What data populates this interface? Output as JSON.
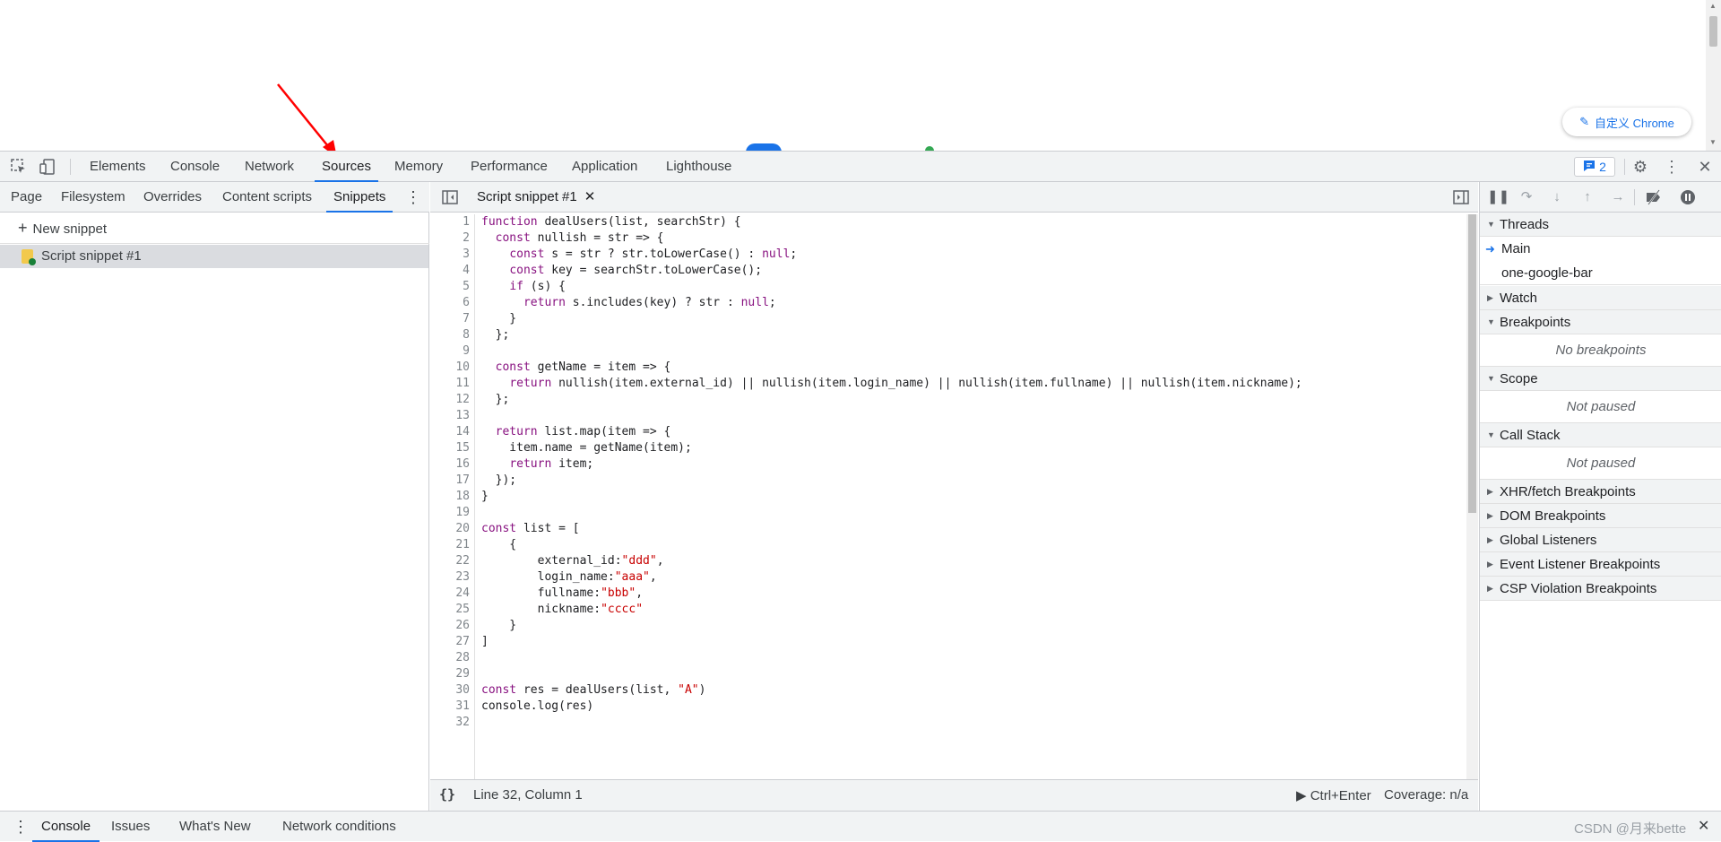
{
  "browser": {
    "customize_label": "自定义 Chrome"
  },
  "devtools": {
    "main_tabs": [
      "Elements",
      "Console",
      "Network",
      "Sources",
      "Memory",
      "Performance",
      "Application",
      "Lighthouse"
    ],
    "active_tab": "Sources",
    "issues_count": "2"
  },
  "navigator": {
    "tabs": [
      "Page",
      "Filesystem",
      "Overrides",
      "Content scripts",
      "Snippets"
    ],
    "active_tab": "Snippets",
    "new_snippet_label": "New snippet",
    "snippets": [
      "Script snippet #1"
    ]
  },
  "editor": {
    "open_file": "Script snippet #1",
    "line_numbers": [
      "1",
      "2",
      "3",
      "4",
      "5",
      "6",
      "7",
      "8",
      "9",
      "10",
      "11",
      "12",
      "13",
      "14",
      "15",
      "16",
      "17",
      "18",
      "19",
      "20",
      "21",
      "22",
      "23",
      "24",
      "25",
      "26",
      "27",
      "28",
      "29",
      "30",
      "31",
      "32"
    ],
    "status_position": "Line 32, Column 1",
    "run_shortcut": "Ctrl+Enter",
    "coverage": "Coverage: n/a"
  },
  "code_lines": [
    "function dealUsers(list, searchStr) {",
    "  const nullish = str => {",
    "    const s = str ? str.toLowerCase() : null;",
    "    const key = searchStr.toLowerCase();",
    "    if (s) {",
    "      return s.includes(key) ? str : null;",
    "    }",
    "  };",
    "",
    "  const getName = item => {",
    "    return nullish(item.external_id) || nullish(item.login_name) || nullish(item.fullname) || nullish(item.nickname);",
    "  };",
    "",
    "  return list.map(item => {",
    "    item.name = getName(item);",
    "    return item;",
    "  });",
    "}",
    "",
    "const list = [",
    "    {",
    "        external_id:\"ddd\",",
    "        login_name:\"aaa\",",
    "        fullname:\"bbb\",",
    "        nickname:\"cccc\"",
    "    }",
    "]",
    "",
    "",
    "const res = dealUsers(list, \"A\")",
    "console.log(res)",
    ""
  ],
  "debugger": {
    "threads_label": "Threads",
    "threads": [
      "Main",
      "one-google-bar"
    ],
    "watch_label": "Watch",
    "breakpoints_label": "Breakpoints",
    "no_breakpoints": "No breakpoints",
    "scope_label": "Scope",
    "scope_status": "Not paused",
    "callstack_label": "Call Stack",
    "callstack_status": "Not paused",
    "collapsed_sections": [
      "XHR/fetch Breakpoints",
      "DOM Breakpoints",
      "Global Listeners",
      "Event Listener Breakpoints",
      "CSP Violation Breakpoints"
    ]
  },
  "drawer": {
    "tabs": [
      "Console",
      "Issues",
      "What's New",
      "Network conditions"
    ],
    "active_tab": "Console"
  },
  "watermark": "CSDN @月来bette",
  "colors": {
    "accent": "#1a73e8",
    "toolbar_bg": "#f1f3f4",
    "keyword": "#881280",
    "string": "#c80000",
    "annotation_arrow": "#ff0000"
  }
}
